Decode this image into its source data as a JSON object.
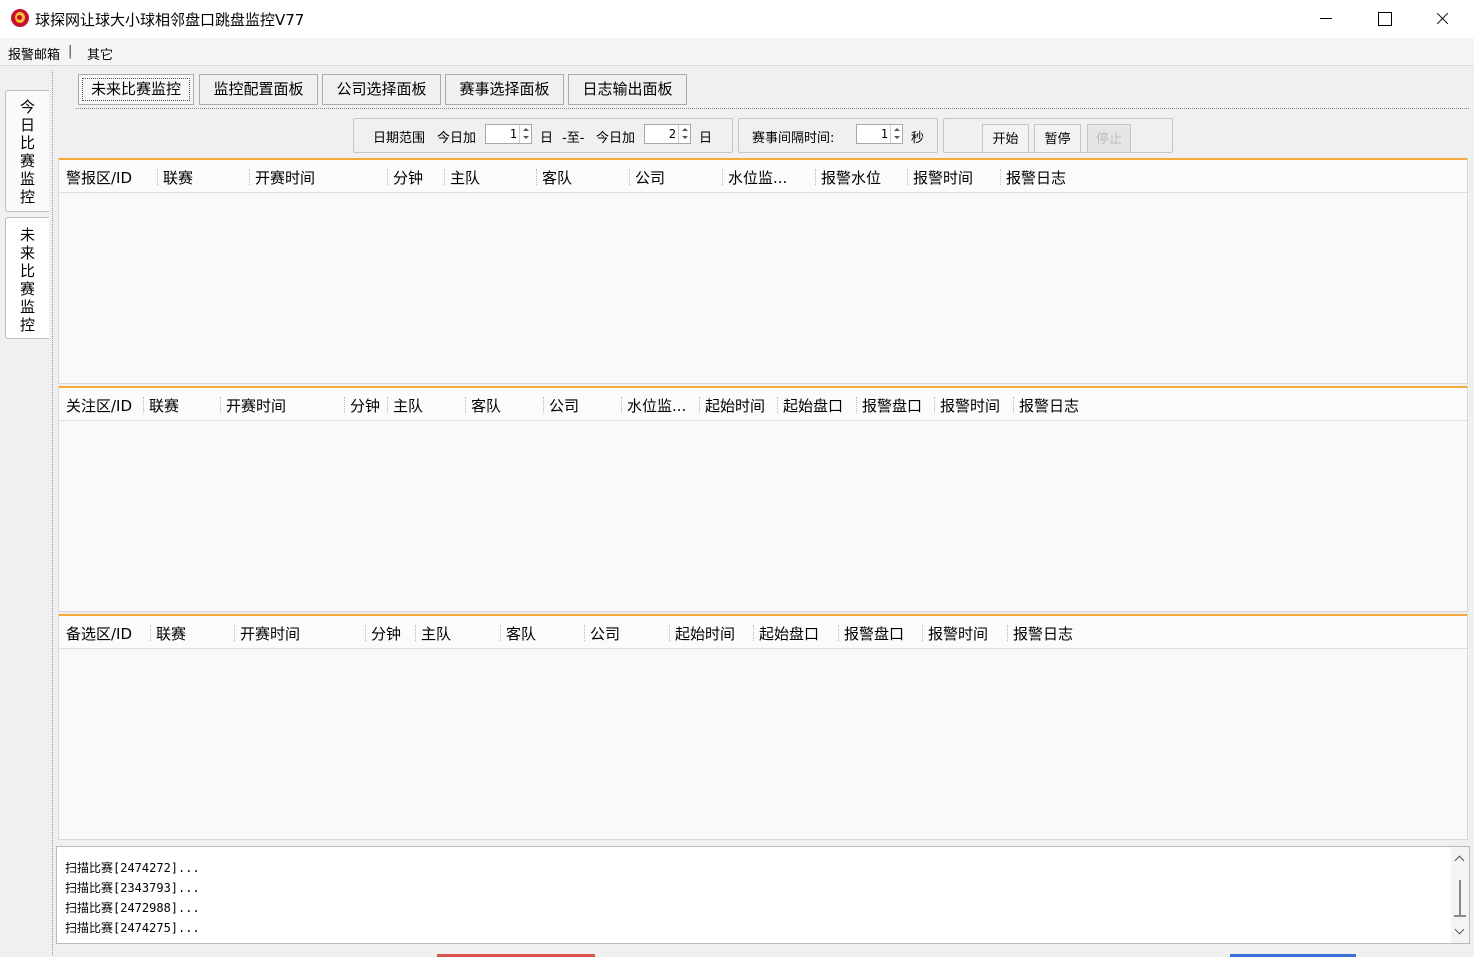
{
  "window": {
    "title": "球探网让球大小球相邻盘口跳盘监控V77"
  },
  "menu": {
    "items": [
      "报警邮箱",
      "其它"
    ],
    "separator": "|"
  },
  "left_tabs": [
    {
      "label": "今日比赛监控"
    },
    {
      "label": "未来比赛监控"
    }
  ],
  "top_tabs": [
    {
      "label": "未来比赛监控",
      "active": true
    },
    {
      "label": "监控配置面板"
    },
    {
      "label": "公司选择面板"
    },
    {
      "label": "赛事选择面板"
    },
    {
      "label": "日志输出面板"
    }
  ],
  "controls": {
    "date_range_label": "日期范围",
    "today_plus_label_1": "今日加",
    "start_day_value": "1",
    "day_unit_1": "日",
    "to_label": "-至-",
    "today_plus_label_2": "今日加",
    "end_day_value": "2",
    "day_unit_2": "日",
    "interval_label": "赛事间隔时间:",
    "interval_value": "1",
    "seconds_unit": "秒",
    "start_button": "开始",
    "pause_button": "暂停",
    "stop_button": "停止"
  },
  "alert_grid": {
    "columns": [
      "警报区/ID",
      "联赛",
      "开赛时间",
      "分钟",
      "主队",
      "客队",
      "公司",
      "水位监...",
      "报警水位",
      "报警时间",
      "报警日志"
    ]
  },
  "watch_grid": {
    "columns": [
      "关注区/ID",
      "联赛",
      "开赛时间",
      "分钟",
      "主队",
      "客队",
      "公司",
      "水位监...",
      "起始时间",
      "起始盘口",
      "报警盘口",
      "报警时间",
      "报警日志"
    ]
  },
  "backup_grid": {
    "columns": [
      "备选区/ID",
      "联赛",
      "开赛时间",
      "分钟",
      "主队",
      "客队",
      "公司",
      "起始时间",
      "起始盘口",
      "报警盘口",
      "报警时间",
      "报警日志"
    ]
  },
  "log": {
    "lines": [
      "扫描比赛[2474272]...",
      "扫描比赛[2343793]...",
      "扫描比赛[2472988]...",
      "扫描比赛[2474275]..."
    ]
  },
  "colors": {
    "grid_accent": "#f3a93b",
    "window_bg": "#f0f0f0"
  }
}
